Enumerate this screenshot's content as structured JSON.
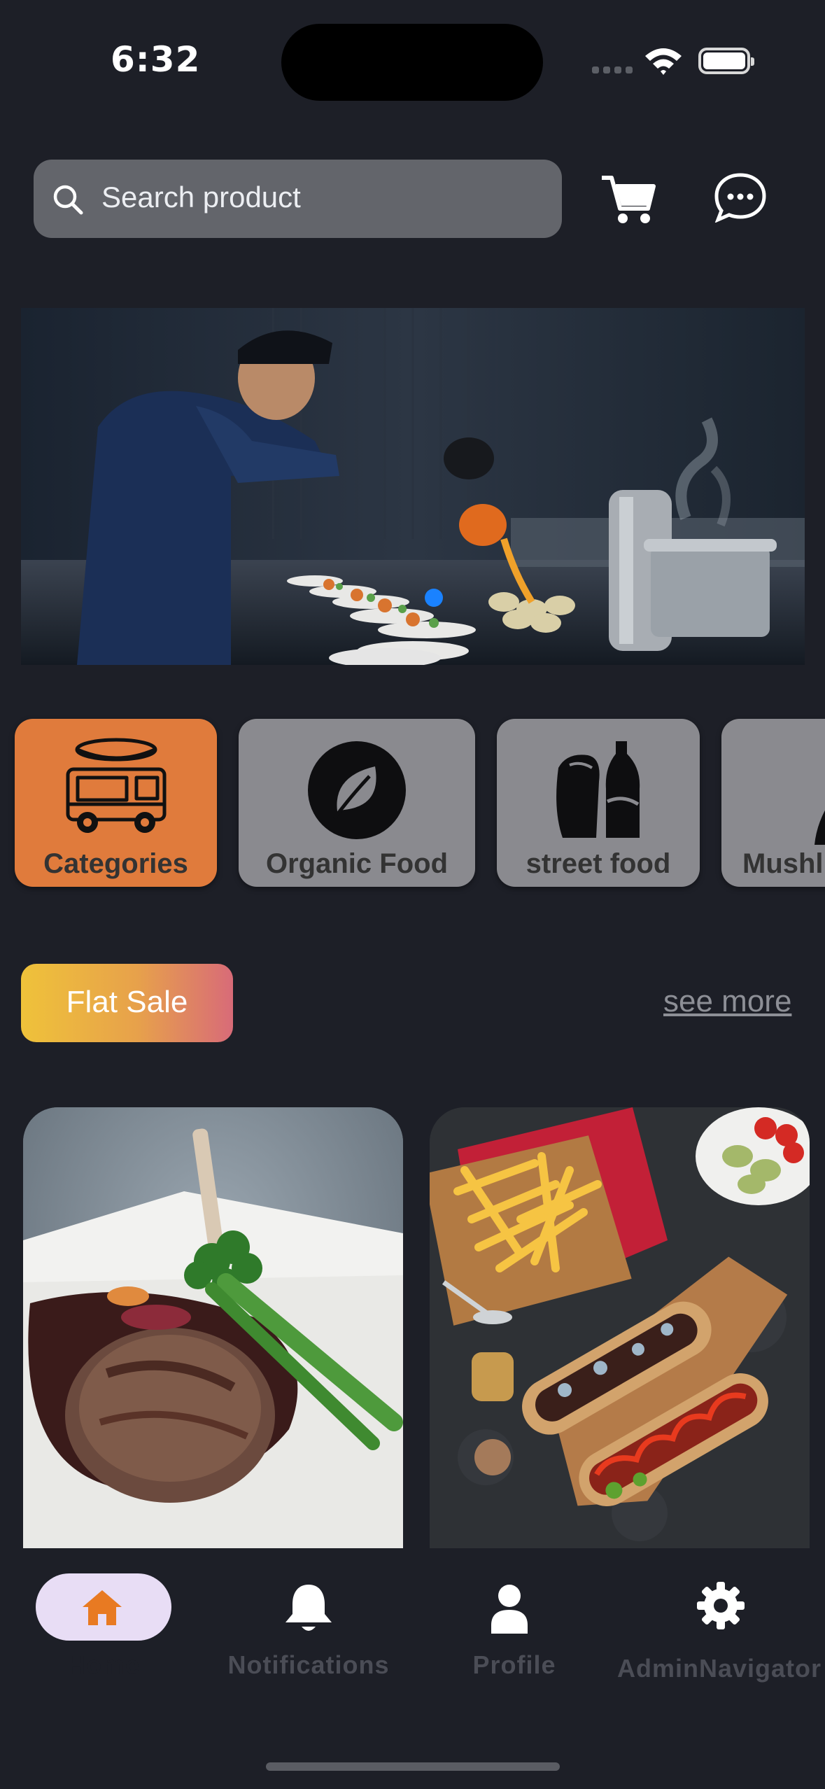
{
  "status_bar": {
    "time": "6:32"
  },
  "search": {
    "placeholder": "Search product"
  },
  "categories": [
    {
      "label": "Categories",
      "icon": "food-truck-icon"
    },
    {
      "label": "Organic Food",
      "icon": "leaf-icon"
    },
    {
      "label": "street food",
      "icon": "burrito-soda-icon"
    },
    {
      "label": "Mushl",
      "icon": "mushroom-icon"
    }
  ],
  "promo": {
    "flat_sale_label": "Flat Sale",
    "see_more_label": "see more"
  },
  "products": [
    {
      "image": "steak-plate-photo"
    },
    {
      "image": "hot-dogs-fries-photo"
    }
  ],
  "nav": {
    "items": [
      {
        "label": "Home",
        "icon": "home-icon",
        "active": true
      },
      {
        "label": "Notifications",
        "icon": "bell-icon"
      },
      {
        "label": "Profile",
        "icon": "person-icon"
      },
      {
        "label": "AdminNavigator",
        "icon": "gear-icon"
      }
    ]
  },
  "colors": {
    "background": "#1d1f27",
    "accent": "#e07b3c",
    "active_pill": "#e8ddf5",
    "banner_dot": "#1a82ff"
  }
}
